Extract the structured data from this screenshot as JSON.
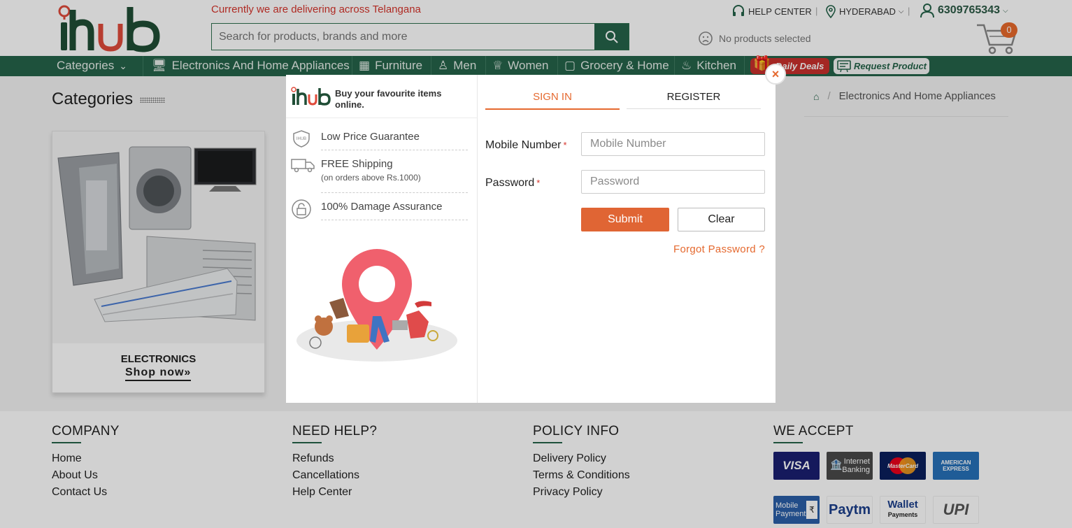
{
  "header": {
    "delivery_text": "Currently we are delivering across Telangana",
    "search_placeholder": "Search for products, brands and more",
    "help_center": "HELP CENTER",
    "location": "HYDERABAD",
    "phone": "6309765343",
    "no_products": "No products selected",
    "cart_count": "0",
    "brand_color": "#25634a",
    "accent_color": "#e5692f"
  },
  "nav": {
    "categories": "Categories",
    "items": [
      "Electronics And Home Appliances",
      "Furniture",
      "Men",
      "Women",
      "Grocery & Home",
      "Kitchen"
    ],
    "daily_deals": "Daily Deals",
    "request_product": "Request Product"
  },
  "main": {
    "title": "Categories",
    "breadcrumb_current": "Electronics And Home Appliances",
    "card_label": "ELECTRONICS",
    "card_link": "Shop now»"
  },
  "modal": {
    "tagline": "Buy your favourite items online.",
    "features": [
      {
        "title": "Low Price Guarantee",
        "sub": "",
        "icon": "shield-icon"
      },
      {
        "title": "FREE Shipping",
        "sub": "(on orders above Rs.1000)",
        "icon": "truck-icon"
      },
      {
        "title": "100% Damage Assurance",
        "sub": "",
        "icon": "lock-icon"
      }
    ],
    "tab_signin": "SIGN IN",
    "tab_register": "REGISTER",
    "mobile_label": "Mobile Number",
    "mobile_placeholder": "Mobile Number",
    "password_label": "Password",
    "password_placeholder": "Password",
    "required_mark": "*",
    "submit": "Submit",
    "clear": "Clear",
    "forgot": "Forgot Password ?",
    "close": "×"
  },
  "footer": {
    "company": {
      "title": "COMPANY",
      "links": [
        "Home",
        "About Us",
        "Contact Us"
      ]
    },
    "help": {
      "title": "NEED HELP?",
      "links": [
        "Refunds",
        "Cancellations",
        "Help Center"
      ]
    },
    "policy": {
      "title": "POLICY INFO",
      "links": [
        "Delivery Policy",
        "Terms & Conditions",
        "Privacy Policy"
      ]
    },
    "accept": {
      "title": "WE ACCEPT"
    },
    "payments": {
      "visa": "VISA",
      "internet_banking": "Internet Banking",
      "mastercard": "MasterCard",
      "amex": "AMERICAN EXPRESS",
      "mobile_payment": "Mobile Payment",
      "paytm": "Paytm",
      "wallet": "Wallet",
      "wallet_sub": "Payments",
      "upi": "UPI"
    }
  }
}
